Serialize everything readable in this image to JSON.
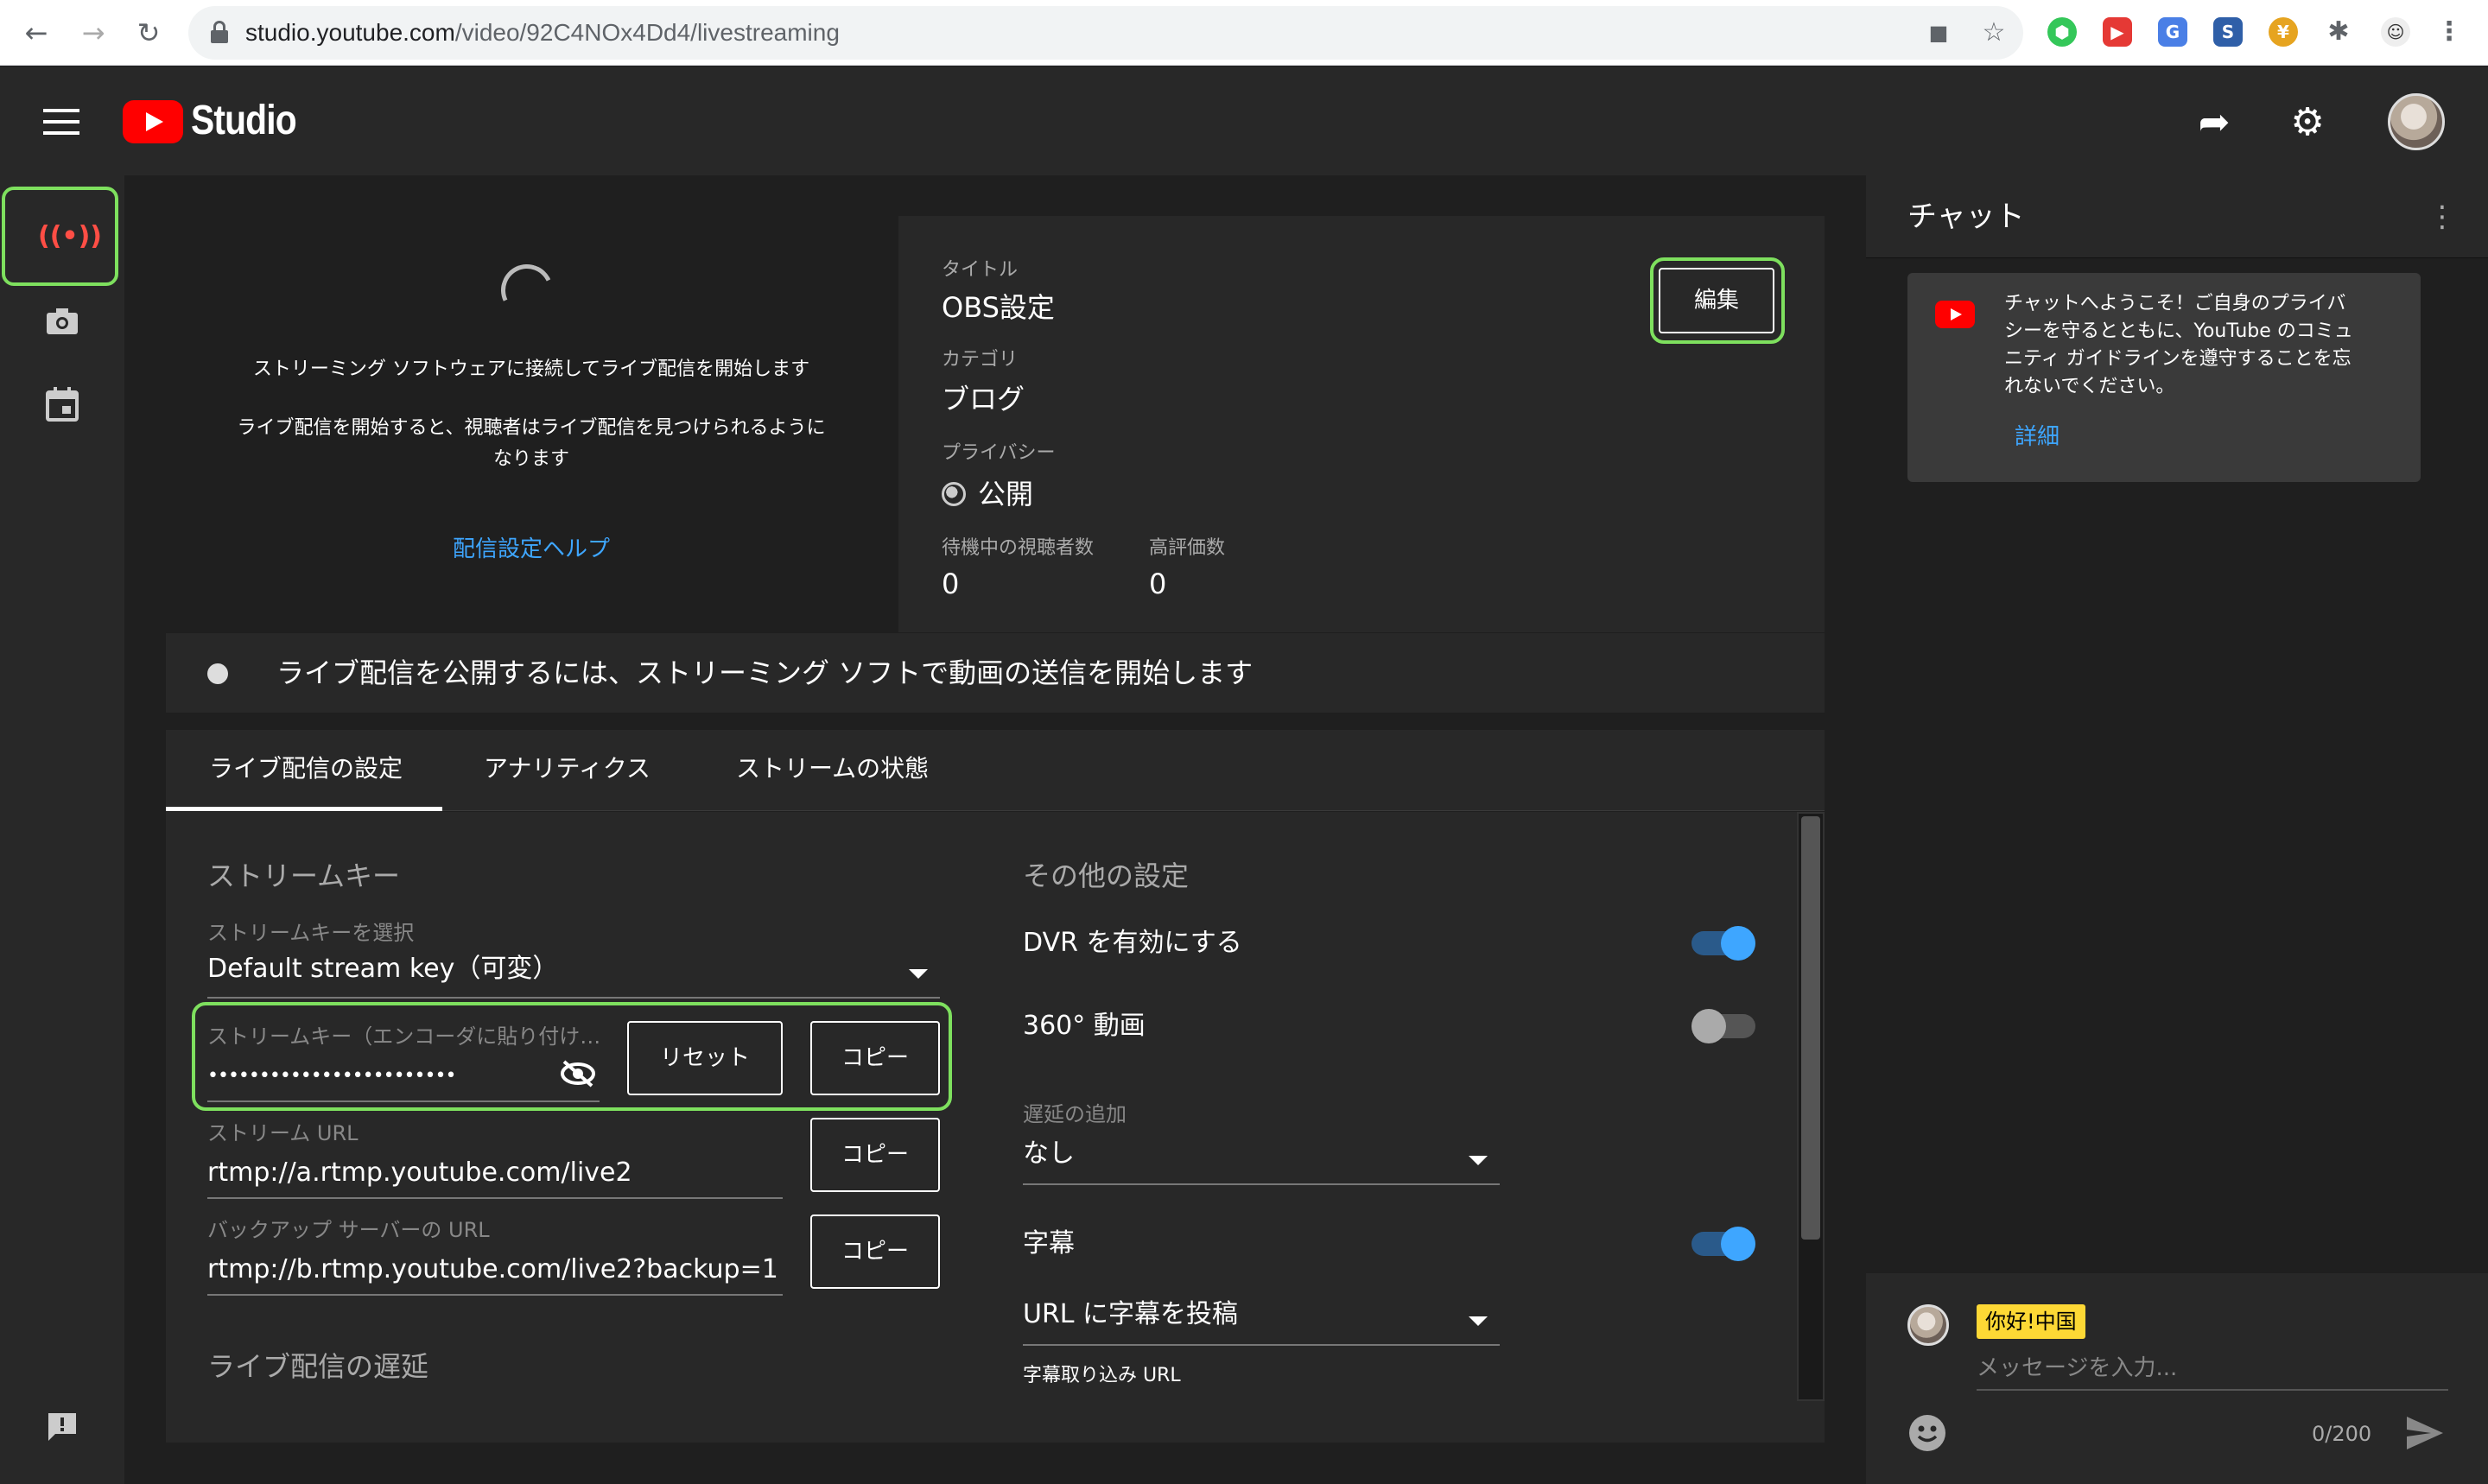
{
  "browser": {
    "url_host": "studio.youtube.com",
    "url_path": "/video/92C4NOx4Dd4/livestreaming"
  },
  "header": {
    "studio_label": "Studio"
  },
  "preview": {
    "line1": "ストリーミング ソフトウェアに接続してライブ配信を開始します",
    "line2a": "ライブ配信を開始すると、視聴者はライブ配信を見つけられるように",
    "line2b": "なります",
    "help_link": "配信設定ヘルプ"
  },
  "info": {
    "title_label": "タイトル",
    "title_value": "OBS設定",
    "category_label": "カテゴリ",
    "category_value": "ブログ",
    "privacy_label": "プライバシー",
    "privacy_value": "公開",
    "waiting_label": "待機中の視聴者数",
    "waiting_value": "0",
    "likes_label": "高評価数",
    "likes_value": "0",
    "edit_button": "編集"
  },
  "status": {
    "text": "ライブ配信を公開するには、ストリーミング ソフトで動画の送信を開始します"
  },
  "tabs": [
    {
      "label": "ライブ配信の設定"
    },
    {
      "label": "アナリティクス"
    },
    {
      "label": "ストリームの状態"
    }
  ],
  "stream_key": {
    "section_title": "ストリームキー",
    "select_label": "ストリームキーを選択",
    "select_value": "Default stream key（可変）",
    "key_label": "ストリームキー（エンコーダに貼り付け…",
    "key_value": "••••••••••••••••••••••••",
    "reset_button": "リセット",
    "copy_button": "コピー",
    "url_label": "ストリーム URL",
    "url_value": "rtmp://a.rtmp.youtube.com/live2",
    "backup_label": "バックアップ サーバーの URL",
    "backup_value": "rtmp://b.rtmp.youtube.com/live2?backup=1",
    "latency_title": "ライブ配信の遅延"
  },
  "other": {
    "section_title": "その他の設定",
    "dvr_label": "DVR を有効にする",
    "dvr_on": true,
    "video360_label": "360° 動画",
    "video360_on": false,
    "delay_label": "遅延の追加",
    "delay_value": "なし",
    "captions_label": "字幕",
    "captions_on": true,
    "captions_select": "URL に字幕を投稿",
    "captions_url_label": "字幕取り込み URL"
  },
  "chat": {
    "title": "チャット",
    "welcome": [
      "チャットへようこそ！ご自身のプライバ",
      "シーを守るとともに、YouTube のコミュ",
      "ニティ ガイドラインを遵守することを忘",
      "れないでください。"
    ],
    "details_link": "詳細",
    "user_tag": "你好!中国",
    "input_placeholder": "メッセージを入力...",
    "char_count": "0/200"
  },
  "colors": {
    "accent_blue": "#3ea6ff",
    "toggle_on": "#3ea6ff",
    "highlight_green": "#7ee05e",
    "youtube_red": "#ff0000"
  }
}
